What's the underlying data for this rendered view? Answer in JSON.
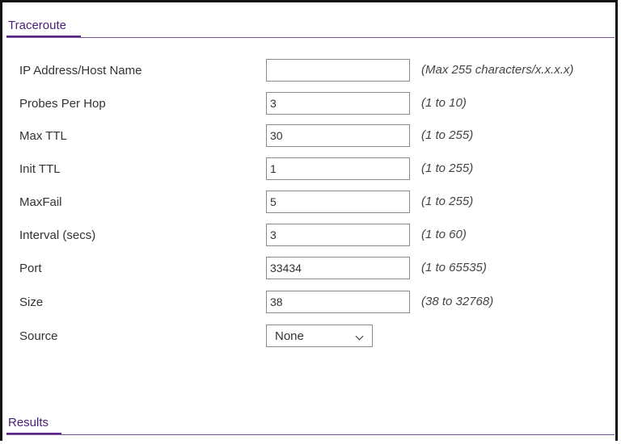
{
  "traceroute": {
    "title": "Traceroute",
    "fields": [
      {
        "label": "IP Address/Host Name",
        "value": "",
        "hint": "(Max 255 characters/x.x.x.x)"
      },
      {
        "label": "Probes Per Hop",
        "value": "3",
        "hint": "(1 to 10)"
      },
      {
        "label": "Max TTL",
        "value": "30",
        "hint": "(1 to 255)"
      },
      {
        "label": "Init TTL",
        "value": "1",
        "hint": "(1 to 255)"
      },
      {
        "label": "MaxFail",
        "value": "5",
        "hint": "(1 to 255)"
      },
      {
        "label": "Interval (secs)",
        "value": "3",
        "hint": "(1 to 60)"
      },
      {
        "label": "Port",
        "value": "33434",
        "hint": "(1 to 65535)"
      },
      {
        "label": "Size",
        "value": "38",
        "hint": "(38 to 32768)"
      }
    ],
    "source": {
      "label": "Source",
      "selected": "None"
    }
  },
  "results": {
    "title": "Results"
  },
  "colors": {
    "accent": "#5a2a86",
    "header_text": "#4b1d7a",
    "frame_border": "#111111"
  },
  "icons": {
    "dropdown": "chevron-down-icon"
  }
}
